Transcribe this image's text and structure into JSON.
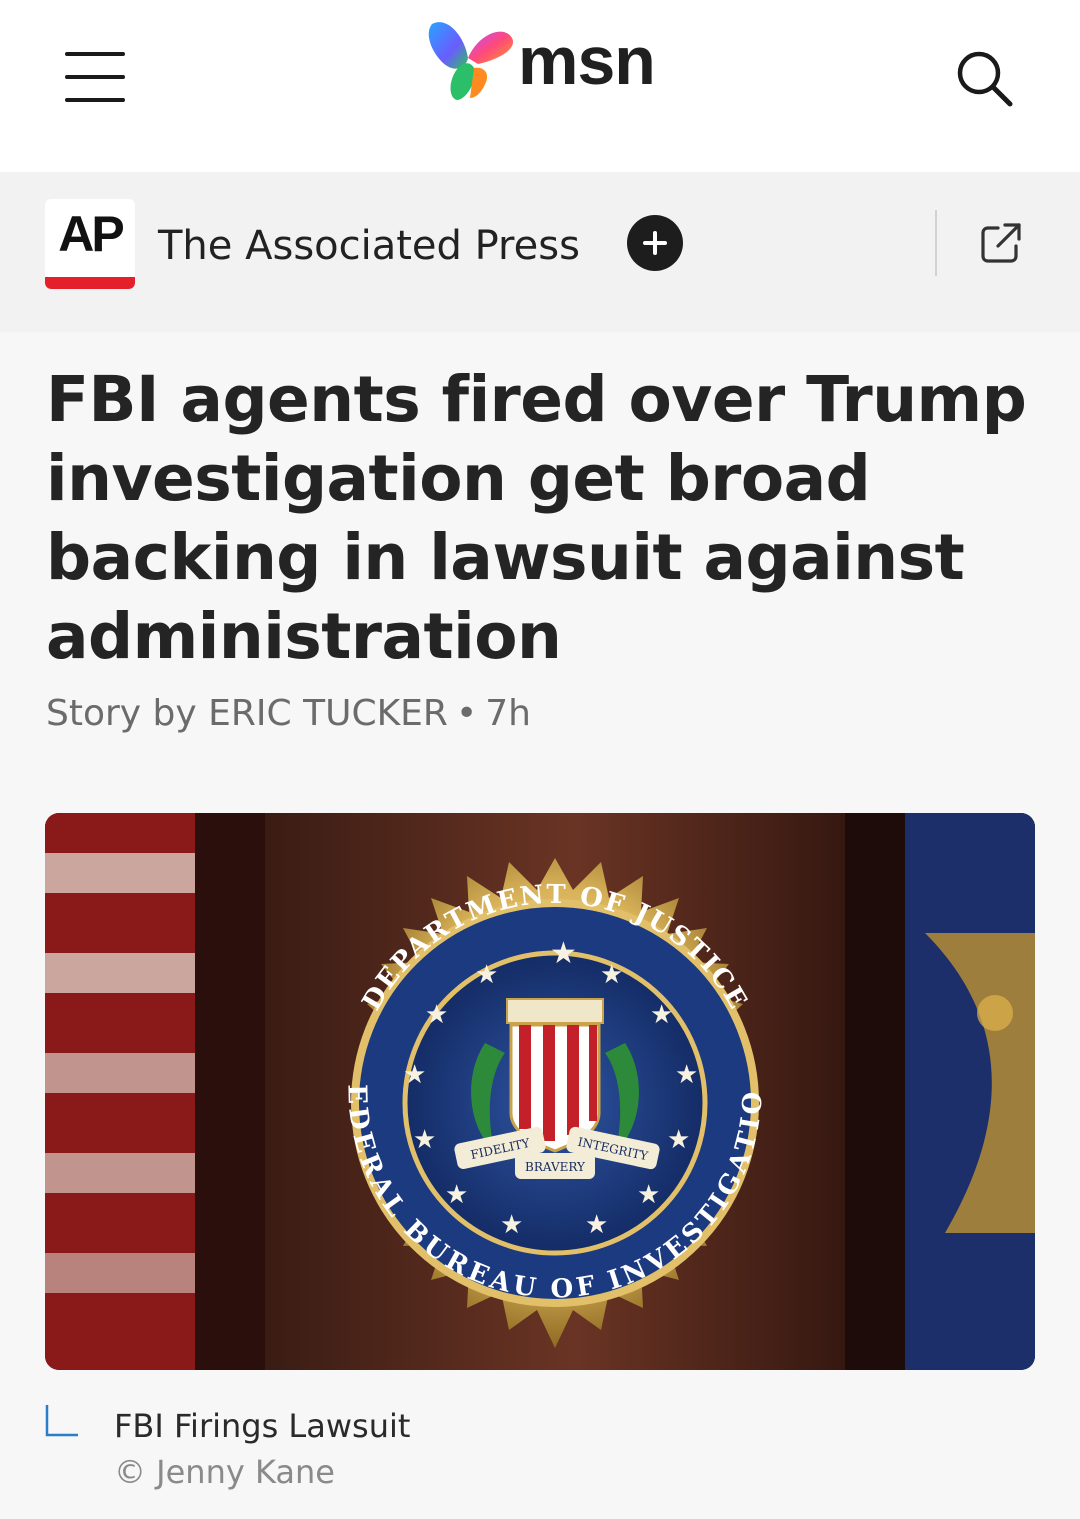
{
  "header": {
    "logo_text": "msn",
    "menu_icon": "hamburger-menu-icon",
    "search_icon": "search-icon"
  },
  "publisher": {
    "logo_text": "AP",
    "name": "The Associated Press",
    "follow_icon": "plus-icon",
    "external_icon": "external-link-icon",
    "brand_color": "#e4212b"
  },
  "article": {
    "headline": "FBI agents fired over Trump investigation get broad backing in lawsuit against administration",
    "byline_prefix": "Story by ERIC TUCKER",
    "byline_separator": "•",
    "age": "7h"
  },
  "image": {
    "seal_top_text": "DEPARTMENT OF JUSTICE",
    "seal_bottom_text": "FEDERAL BUREAU OF INVESTIGATION",
    "motto_left": "FIDELITY",
    "motto_center": "BRAVERY",
    "motto_right": "INTEGRITY",
    "caption": "FBI Firings Lawsuit",
    "credit": "© Jenny Kane"
  }
}
